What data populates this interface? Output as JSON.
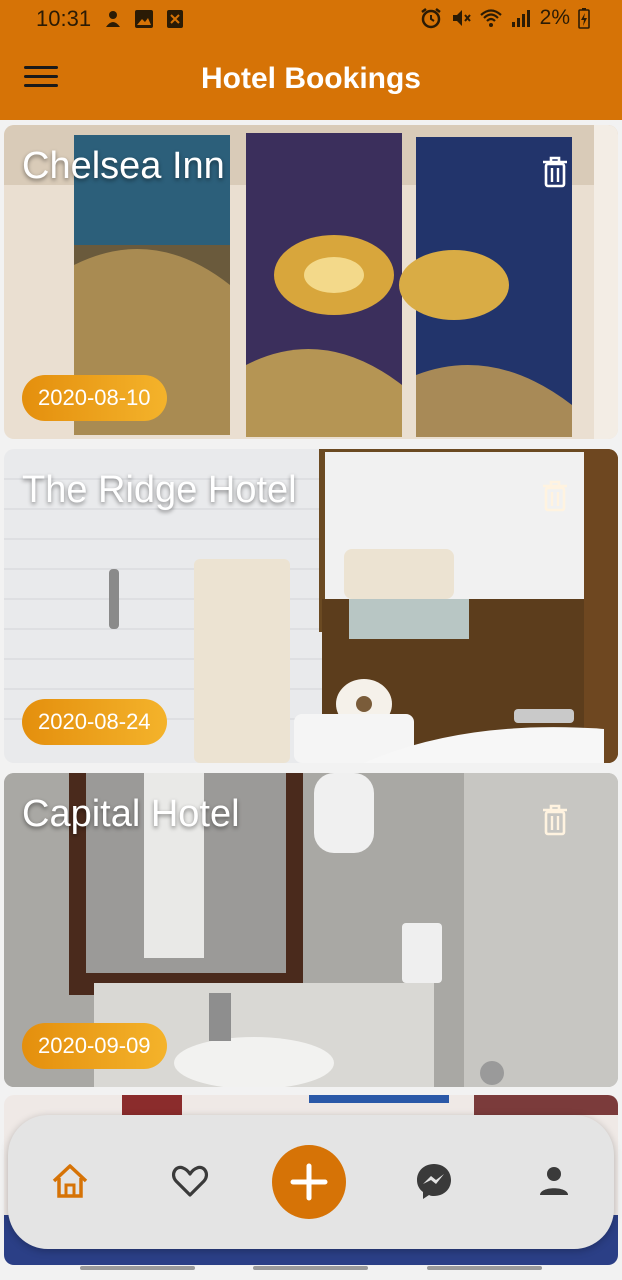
{
  "status_bar": {
    "time": "10:31",
    "battery": "2%"
  },
  "app_bar": {
    "title": "Hotel Bookings",
    "menu_icon": "hamburger-menu-icon"
  },
  "bookings": [
    {
      "name": "Chelsea Inn",
      "date": "2020-08-10"
    },
    {
      "name": "The Ridge Hotel",
      "date": "2020-08-24"
    },
    {
      "name": "Capital Hotel",
      "date": "2020-09-09"
    }
  ],
  "bottom_nav": {
    "items": [
      "home-icon",
      "heart-icon",
      "add-icon",
      "messenger-icon",
      "person-icon"
    ],
    "active": "home-icon"
  },
  "colors": {
    "accent": "#d67306",
    "pill": "#e9961a",
    "nav_bg": "#e4e4e4",
    "inactive_icon": "#3a3a3a"
  }
}
